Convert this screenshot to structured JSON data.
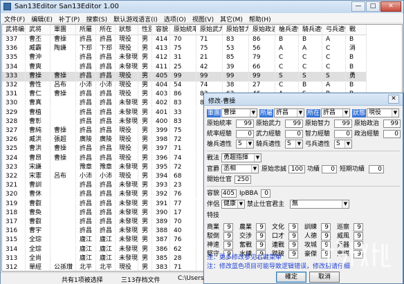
{
  "window": {
    "title": "San13Editor San13Editor 1.00",
    "min": "—",
    "max": "□",
    "close": "✕"
  },
  "menu": [
    "文件(F)",
    "编辑(E)",
    "补丁(P)",
    "搜索(S)",
    "默认游戏语言(I)",
    "选项(O)",
    "视图(V)",
    "其它(M)",
    "帮助(H)"
  ],
  "columns": [
    "武将编号",
    "武将",
    "軍團",
    "所屬",
    "所在",
    "狀態",
    "性別",
    "容貌",
    "原始統率",
    "原始武力",
    "原始智力",
    "原始政治",
    "槍兵適性",
    "騎兵適性",
    "弓兵適性",
    "戰"
  ],
  "rows": [
    [
      "337",
      "曹丕",
      "曹操",
      "許昌",
      "許昌",
      "現役",
      "男",
      "414",
      "70",
      "71",
      "83",
      "86",
      "B",
      "B",
      "A",
      "B"
    ],
    [
      "336",
      "臧霸",
      "陶謙",
      "下邳",
      "下邳",
      "現役",
      "男",
      "413",
      "75",
      "75",
      "53",
      "56",
      "A",
      "A",
      "C",
      "消"
    ],
    [
      "335",
      "曹沖",
      "",
      "許昌",
      "許昌",
      "未發現",
      "男",
      "412",
      "31",
      "21",
      "85",
      "79",
      "C",
      "C",
      "C",
      "B"
    ],
    [
      "334",
      "曹爽",
      "",
      "許昌",
      "許昌",
      "未發現",
      "男",
      "411",
      "25",
      "42",
      "39",
      "66",
      "C",
      "C",
      "C",
      "B"
    ],
    [
      "333",
      "曹操",
      "曹操",
      "許昌",
      "許昌",
      "現役",
      "男",
      "405",
      "99",
      "99",
      "99",
      "99",
      "S",
      "S",
      "S",
      "勇"
    ],
    [
      "332",
      "曹性",
      "呂布",
      "小沛",
      "小沛",
      "現役",
      "男",
      "404",
      "54",
      "74",
      "38",
      "27",
      "C",
      "B",
      "A",
      "B"
    ],
    [
      "331",
      "曹仁",
      "曹操",
      "許昌",
      "許昌",
      "現役",
      "男",
      "403",
      "86",
      "83",
      "62",
      "46",
      "A",
      "S",
      "B",
      "B"
    ],
    [
      "330",
      "曹真",
      "",
      "許昌",
      "許昌",
      "未發現",
      "男",
      "402",
      "83",
      "83",
      "",
      "",
      "",
      "",
      "",
      ""
    ],
    [
      "329",
      "曹植",
      "",
      "許昌",
      "許昌",
      "未發現",
      "男",
      "401",
      "33",
      "",
      "",
      "",
      "",
      "",
      "",
      ""
    ],
    [
      "328",
      "曹彰",
      "",
      "許昌",
      "許昌",
      "未發現",
      "男",
      "400",
      "83",
      "",
      "",
      "",
      "",
      "",
      "",
      ""
    ],
    [
      "327",
      "曹純",
      "曹操",
      "許昌",
      "許昌",
      "現役",
      "男",
      "399",
      "75",
      "",
      "",
      "",
      "",
      "",
      "",
      ""
    ],
    [
      "326",
      "臧洪",
      "張超",
      "廣陵",
      "廣陵",
      "現役",
      "男",
      "398",
      "72",
      "",
      "",
      "",
      "",
      "",
      "",
      ""
    ],
    [
      "325",
      "曹洪",
      "曹操",
      "許昌",
      "許昌",
      "現役",
      "男",
      "397",
      "71",
      "",
      "",
      "",
      "",
      "",
      "",
      ""
    ],
    [
      "324",
      "曹昂",
      "曹操",
      "許昌",
      "許昌",
      "現役",
      "男",
      "396",
      "74",
      "",
      "",
      "",
      "",
      "",
      "",
      ""
    ],
    [
      "323",
      "宋謙",
      "",
      "豫章",
      "豫章",
      "未發現",
      "男",
      "395",
      "72",
      "",
      "",
      "",
      "",
      "",
      "",
      ""
    ],
    [
      "322",
      "宋憲",
      "呂布",
      "小沛",
      "小沛",
      "現役",
      "男",
      "394",
      "68",
      "",
      "",
      "",
      "",
      "",
      "",
      ""
    ],
    [
      "321",
      "曹訓",
      "",
      "許昌",
      "許昌",
      "未發現",
      "男",
      "393",
      "23",
      "",
      "",
      "",
      "",
      "",
      "",
      ""
    ],
    [
      "320",
      "曹休",
      "",
      "許昌",
      "許昌",
      "未發現",
      "男",
      "392",
      "76",
      "",
      "",
      "",
      "",
      "",
      "",
      ""
    ],
    [
      "319",
      "曹叡",
      "",
      "許昌",
      "許昌",
      "未發現",
      "男",
      "391",
      "77",
      "",
      "",
      "",
      "",
      "",
      "",
      ""
    ],
    [
      "318",
      "曹奐",
      "",
      "許昌",
      "許昌",
      "未發現",
      "男",
      "390",
      "17",
      "",
      "",
      "",
      "",
      "",
      "",
      ""
    ],
    [
      "317",
      "曹叡",
      "",
      "許昌",
      "許昌",
      "未發現",
      "男",
      "389",
      "70",
      "",
      "",
      "",
      "",
      "",
      "",
      ""
    ],
    [
      "316",
      "曹宇",
      "",
      "許昌",
      "許昌",
      "未發現",
      "男",
      "388",
      "40",
      "",
      "",
      "",
      "",
      "",
      "",
      ""
    ],
    [
      "315",
      "全琮",
      "",
      "廬江",
      "廬江",
      "未發現",
      "男",
      "387",
      "76",
      "",
      "",
      "",
      "",
      "",
      "",
      ""
    ],
    [
      "314",
      "全琮",
      "",
      "廬江",
      "廬江",
      "未發現",
      "男",
      "386",
      "62",
      "",
      "",
      "",
      "",
      "",
      "",
      ""
    ],
    [
      "313",
      "全尚",
      "",
      "廬江",
      "廬江",
      "未發現",
      "男",
      "385",
      "28",
      "",
      "",
      "",
      "",
      "",
      "",
      ""
    ],
    [
      "312",
      "單經",
      "公孫瓚",
      "北平",
      "北平",
      "現役",
      "男",
      "383",
      "71",
      "",
      "",
      "",
      "",
      "",
      "",
      ""
    ]
  ],
  "selected_row": 4,
  "status": {
    "selection": "共有1项被选择",
    "file": "三13存档文件",
    "path": "C:\\Users\\"
  },
  "dialog": {
    "title": "修改-曹操",
    "close": "✕",
    "labels": {
      "army": "軍團",
      "belong": "所屬",
      "location": "所在",
      "state": "狀態",
      "lead": "原始統率",
      "war": "原始武力",
      "int": "原始智力",
      "pol": "原始政治",
      "lead_exp": "統率經驗",
      "war_exp": "武力經驗",
      "int_exp": "智力經驗",
      "pol_exp": "政治經驗",
      "spear": "槍兵適性",
      "horse": "騎兵適性",
      "bow": "弓兵適性",
      "tactic": "戰法",
      "rank": "官爵",
      "loyalty": "原始忠誠",
      "merit": "功績",
      "short_merit": "短期功績",
      "first_year": "開始仕官",
      "face": "容貌",
      "face_code": "IpBBA",
      "spouse": "伴侶",
      "forbid_lord": "禁止仕官君主",
      "skills": "特技"
    },
    "values": {
      "army": "曹操",
      "belong": "許昌",
      "location": "許昌",
      "state": "現役",
      "lead": "99",
      "war": "99",
      "int": "99",
      "pol": "99",
      "lead_exp": "0",
      "war_exp": "0",
      "int_exp": "0",
      "pol_exp": "0",
      "spear": "S",
      "horse": "S",
      "bow": "S",
      "tactic": "勇趨指揮",
      "rank": "丞相",
      "loyalty": "100",
      "merit": "0",
      "short_merit": "0",
      "first_year": "250",
      "face": "405",
      "face_code": "0",
      "spouse": "健康",
      "forbid_lord": "無"
    },
    "skills": [
      {
        "name": "商業",
        "value": "9"
      },
      {
        "name": "農業",
        "value": "9"
      },
      {
        "name": "文化",
        "value": "9"
      },
      {
        "name": "訓練",
        "value": "9"
      },
      {
        "name": "巡察",
        "value": "9"
      },
      {
        "name": "駁倒",
        "value": "9"
      },
      {
        "name": "交涉",
        "value": "9"
      },
      {
        "name": "口才",
        "value": "9"
      },
      {
        "name": "人德",
        "value": "9"
      },
      {
        "name": "威風",
        "value": "9"
      },
      {
        "name": "神速",
        "value": "9"
      },
      {
        "name": "奮戰",
        "value": "9"
      },
      {
        "name": "連戰",
        "value": "9"
      },
      {
        "name": "攻城",
        "value": "9"
      },
      {
        "name": "兵器",
        "value": "9"
      },
      {
        "name": "堅守",
        "value": "9"
      },
      {
        "name": "水練",
        "value": "9"
      },
      {
        "name": "踏破",
        "value": "9"
      },
      {
        "name": "豪傑",
        "value": "9"
      },
      {
        "name": "鬼謀",
        "value": "9"
      }
    ],
    "note1": "注：更多修改参见右键菜单",
    "note2": "注：修改蓝色项目可能导致逻辑错误，修改前请仔细"
  },
  "ok_label": "確定",
  "cancel_label": "取消",
  "colors": {
    "selection": "#3875d7",
    "note_blue": "#1f3fd1",
    "note_red": "#c00000"
  }
}
